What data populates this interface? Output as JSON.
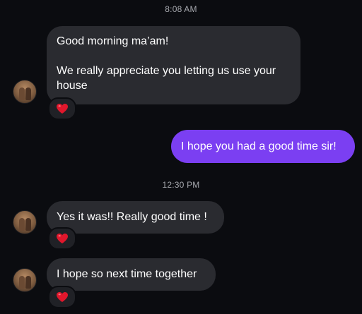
{
  "conversation": {
    "timestamps": [
      "8:08 AM",
      "12:30 PM"
    ],
    "messages": [
      {
        "direction": "incoming",
        "text": "Good morning ma’am!\n\nWe really appreciate you letting us use your house",
        "reaction": "red-heart"
      },
      {
        "direction": "outgoing",
        "text": "I hope you had a good time sir!"
      },
      {
        "direction": "incoming",
        "text": "Yes it was!! Really good time !",
        "reaction": "red-heart"
      },
      {
        "direction": "incoming",
        "text": "I hope so next time together",
        "reaction": "red-heart"
      }
    ]
  },
  "colors": {
    "background": "#0b0c10",
    "incoming_bubble": "#2a2b30",
    "outgoing_bubble": "#7b3ff2",
    "timestamp_text": "#a6a8ae",
    "heart": "#e0172c"
  },
  "icons": {
    "reaction": "red-heart-icon"
  }
}
